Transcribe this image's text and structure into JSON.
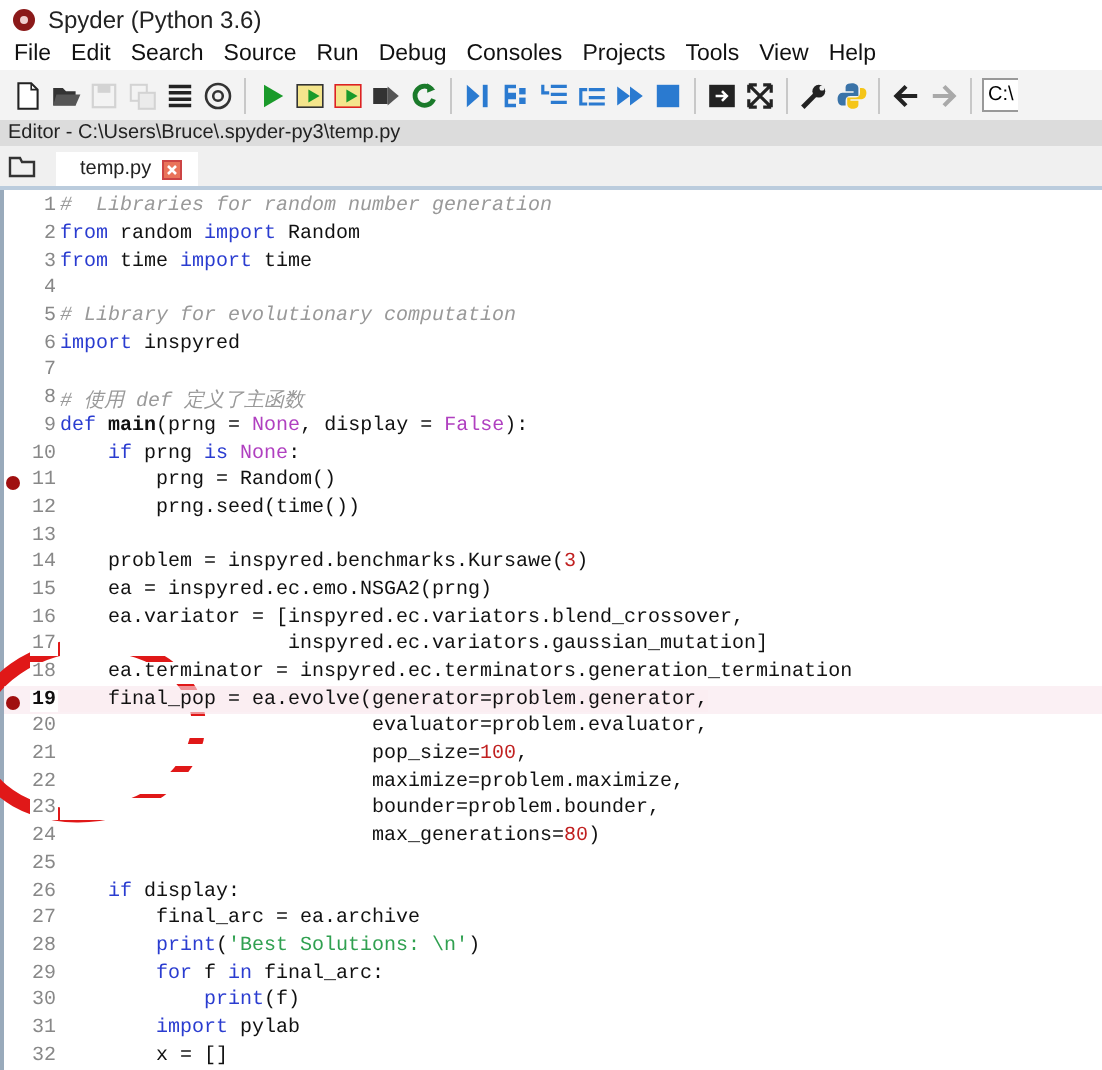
{
  "window": {
    "title": "Spyder (Python 3.6)"
  },
  "menu": [
    "File",
    "Edit",
    "Search",
    "Source",
    "Run",
    "Debug",
    "Consoles",
    "Projects",
    "Tools",
    "View",
    "Help"
  ],
  "toolbar": [
    [
      {
        "kind": "new",
        "disabled": false
      },
      {
        "kind": "open",
        "disabled": false
      },
      {
        "kind": "save",
        "disabled": true
      },
      {
        "kind": "saveall",
        "disabled": true
      },
      {
        "kind": "list",
        "disabled": false
      },
      {
        "kind": "at",
        "disabled": false
      }
    ],
    [
      {
        "kind": "run",
        "disabled": false
      },
      {
        "kind": "runcell",
        "disabled": false
      },
      {
        "kind": "runcellnext",
        "disabled": false
      },
      {
        "kind": "runsel",
        "disabled": false
      },
      {
        "kind": "rerun",
        "disabled": false
      }
    ],
    [
      {
        "kind": "debug",
        "disabled": false
      },
      {
        "kind": "step",
        "disabled": false
      },
      {
        "kind": "stepin",
        "disabled": false
      },
      {
        "kind": "stepout",
        "disabled": false
      },
      {
        "kind": "continue",
        "disabled": false
      },
      {
        "kind": "stop",
        "disabled": false
      }
    ],
    [
      {
        "kind": "maximize",
        "disabled": false
      },
      {
        "kind": "fullscreen",
        "disabled": false
      }
    ],
    [
      {
        "kind": "wrench",
        "disabled": false
      },
      {
        "kind": "python",
        "disabled": false
      }
    ],
    [
      {
        "kind": "back",
        "disabled": false
      },
      {
        "kind": "forward",
        "disabled": true
      }
    ]
  ],
  "path_field": {
    "value": "C:\\"
  },
  "editor": {
    "title": "Editor - C:\\Users\\Bruce\\.spyder-py3\\temp.py",
    "tabs": [
      {
        "label": "temp.py",
        "selected": true
      }
    ]
  },
  "lines": [
    {
      "number": "1",
      "breakpoint": false,
      "current": false,
      "tokens": [
        {
          "kind": "comment",
          "text": "#  Libraries for random number generation"
        }
      ]
    },
    {
      "number": "2",
      "breakpoint": false,
      "current": false,
      "tokens": [
        {
          "kind": "kw",
          "text": "from"
        },
        {
          "kind": "plain",
          "text": " random "
        },
        {
          "kind": "kw",
          "text": "import"
        },
        {
          "kind": "plain",
          "text": " Random"
        }
      ]
    },
    {
      "number": "3",
      "breakpoint": false,
      "current": false,
      "tokens": [
        {
          "kind": "kw",
          "text": "from"
        },
        {
          "kind": "plain",
          "text": " time "
        },
        {
          "kind": "kw",
          "text": "import"
        },
        {
          "kind": "plain",
          "text": " time"
        }
      ]
    },
    {
      "number": "4",
      "breakpoint": false,
      "current": false
    },
    {
      "number": "5",
      "breakpoint": false,
      "current": false,
      "tokens": [
        {
          "kind": "comment",
          "text": "# Library for evolutionary computation"
        }
      ]
    },
    {
      "number": "6",
      "breakpoint": false,
      "current": false,
      "tokens": [
        {
          "kind": "kw",
          "text": "import"
        },
        {
          "kind": "plain",
          "text": " inspyred"
        }
      ]
    },
    {
      "number": "7",
      "breakpoint": false,
      "current": false
    },
    {
      "number": "8",
      "breakpoint": false,
      "current": false,
      "tokens": [
        {
          "kind": "comment",
          "text": "# 使用 def 定义了主函数"
        }
      ]
    },
    {
      "number": "9",
      "breakpoint": false,
      "current": false,
      "tokens": [
        {
          "kind": "kw",
          "text": "def "
        },
        {
          "kind": "name",
          "text": "main"
        },
        {
          "kind": "plain",
          "text": "(prng = "
        },
        {
          "kind": "const",
          "text": "None"
        },
        {
          "kind": "plain",
          "text": ", display = "
        },
        {
          "kind": "const",
          "text": "False"
        },
        {
          "kind": "plain",
          "text": "):"
        }
      ]
    },
    {
      "number": "10",
      "breakpoint": false,
      "current": false,
      "tokens": [
        {
          "kind": "kw",
          "text": "    if"
        },
        {
          "kind": "plain",
          "text": " prng "
        },
        {
          "kind": "kw",
          "text": "is "
        },
        {
          "kind": "const",
          "text": "None"
        },
        {
          "kind": "plain",
          "text": ":"
        }
      ]
    },
    {
      "number": "11",
      "breakpoint": true,
      "current": false,
      "tokens": [
        {
          "kind": "plain",
          "text": "        prng = Random()"
        }
      ]
    },
    {
      "number": "12",
      "breakpoint": false,
      "current": false,
      "tokens": [
        {
          "kind": "plain",
          "text": "        prng.seed(time())"
        }
      ]
    },
    {
      "number": "13",
      "breakpoint": false,
      "current": false
    },
    {
      "number": "14",
      "breakpoint": false,
      "current": false,
      "tokens": [
        {
          "kind": "plain",
          "text": "    problem = inspyred.benchmarks.Kursawe("
        },
        {
          "kind": "num",
          "text": "3"
        },
        {
          "kind": "plain",
          "text": ")"
        }
      ]
    },
    {
      "number": "15",
      "breakpoint": false,
      "current": false,
      "tokens": [
        {
          "kind": "plain",
          "text": "    ea = inspyred.ec.emo.NSGA2(prng)"
        }
      ]
    },
    {
      "number": "16",
      "breakpoint": false,
      "current": false,
      "tokens": [
        {
          "kind": "plain",
          "text": "    ea.variator = [inspyred.ec.variators.blend_crossover,"
        }
      ]
    },
    {
      "number": "17",
      "breakpoint": false,
      "current": false,
      "tokens": [
        {
          "kind": "plain",
          "text": "                   inspyred.ec.variators.gaussian_mutation]"
        }
      ]
    },
    {
      "number": "18",
      "breakpoint": false,
      "current": false,
      "tokens": [
        {
          "kind": "plain",
          "text": "    ea.terminator = inspyred.ec.terminators.generation_termination"
        }
      ]
    },
    {
      "number": "19",
      "breakpoint": true,
      "current": true,
      "tokens": [
        {
          "kind": "plain",
          "text": "    final_pop = ea.evolve(generator=problem.generator,"
        }
      ]
    },
    {
      "number": "20",
      "breakpoint": false,
      "current": false,
      "tokens": [
        {
          "kind": "plain",
          "text": "                          evaluator=problem.evaluator,"
        }
      ]
    },
    {
      "number": "21",
      "breakpoint": false,
      "current": false,
      "tokens": [
        {
          "kind": "plain",
          "text": "                          pop_size="
        },
        {
          "kind": "num",
          "text": "100"
        },
        {
          "kind": "plain",
          "text": ","
        }
      ]
    },
    {
      "number": "22",
      "breakpoint": false,
      "current": false,
      "tokens": [
        {
          "kind": "plain",
          "text": "                          maximize=problem.maximize,"
        }
      ]
    },
    {
      "number": "23",
      "breakpoint": false,
      "current": false,
      "tokens": [
        {
          "kind": "plain",
          "text": "                          bounder=problem.bounder,"
        }
      ]
    },
    {
      "number": "24",
      "breakpoint": false,
      "current": false,
      "tokens": [
        {
          "kind": "plain",
          "text": "                          max_generations="
        },
        {
          "kind": "num",
          "text": "80"
        },
        {
          "kind": "plain",
          "text": ")"
        }
      ]
    },
    {
      "number": "25",
      "breakpoint": false,
      "current": false
    },
    {
      "number": "26",
      "breakpoint": false,
      "current": false,
      "tokens": [
        {
          "kind": "kw",
          "text": "    if"
        },
        {
          "kind": "plain",
          "text": " display:"
        }
      ]
    },
    {
      "number": "27",
      "breakpoint": false,
      "current": false,
      "tokens": [
        {
          "kind": "plain",
          "text": "        final_arc = ea.archive"
        }
      ]
    },
    {
      "number": "28",
      "breakpoint": false,
      "current": false,
      "tokens": [
        {
          "kind": "kw",
          "text": "        print"
        },
        {
          "kind": "plain",
          "text": "("
        },
        {
          "kind": "str",
          "text": "'Best Solutions: \\n'"
        },
        {
          "kind": "plain",
          "text": ")"
        }
      ]
    },
    {
      "number": "29",
      "breakpoint": false,
      "current": false,
      "tokens": [
        {
          "kind": "kw",
          "text": "        for"
        },
        {
          "kind": "plain",
          "text": " f "
        },
        {
          "kind": "kw",
          "text": "in"
        },
        {
          "kind": "plain",
          "text": " final_arc:"
        }
      ]
    },
    {
      "number": "30",
      "breakpoint": false,
      "current": false,
      "tokens": [
        {
          "kind": "kw",
          "text": "            print"
        },
        {
          "kind": "plain",
          "text": "(f)"
        }
      ]
    },
    {
      "number": "31",
      "breakpoint": false,
      "current": false,
      "tokens": [
        {
          "kind": "kw",
          "text": "        import"
        },
        {
          "kind": "plain",
          "text": " pylab"
        }
      ]
    },
    {
      "number": "32",
      "breakpoint": false,
      "current": false,
      "tokens": [
        {
          "kind": "plain",
          "text": "        x = []"
        }
      ]
    }
  ]
}
